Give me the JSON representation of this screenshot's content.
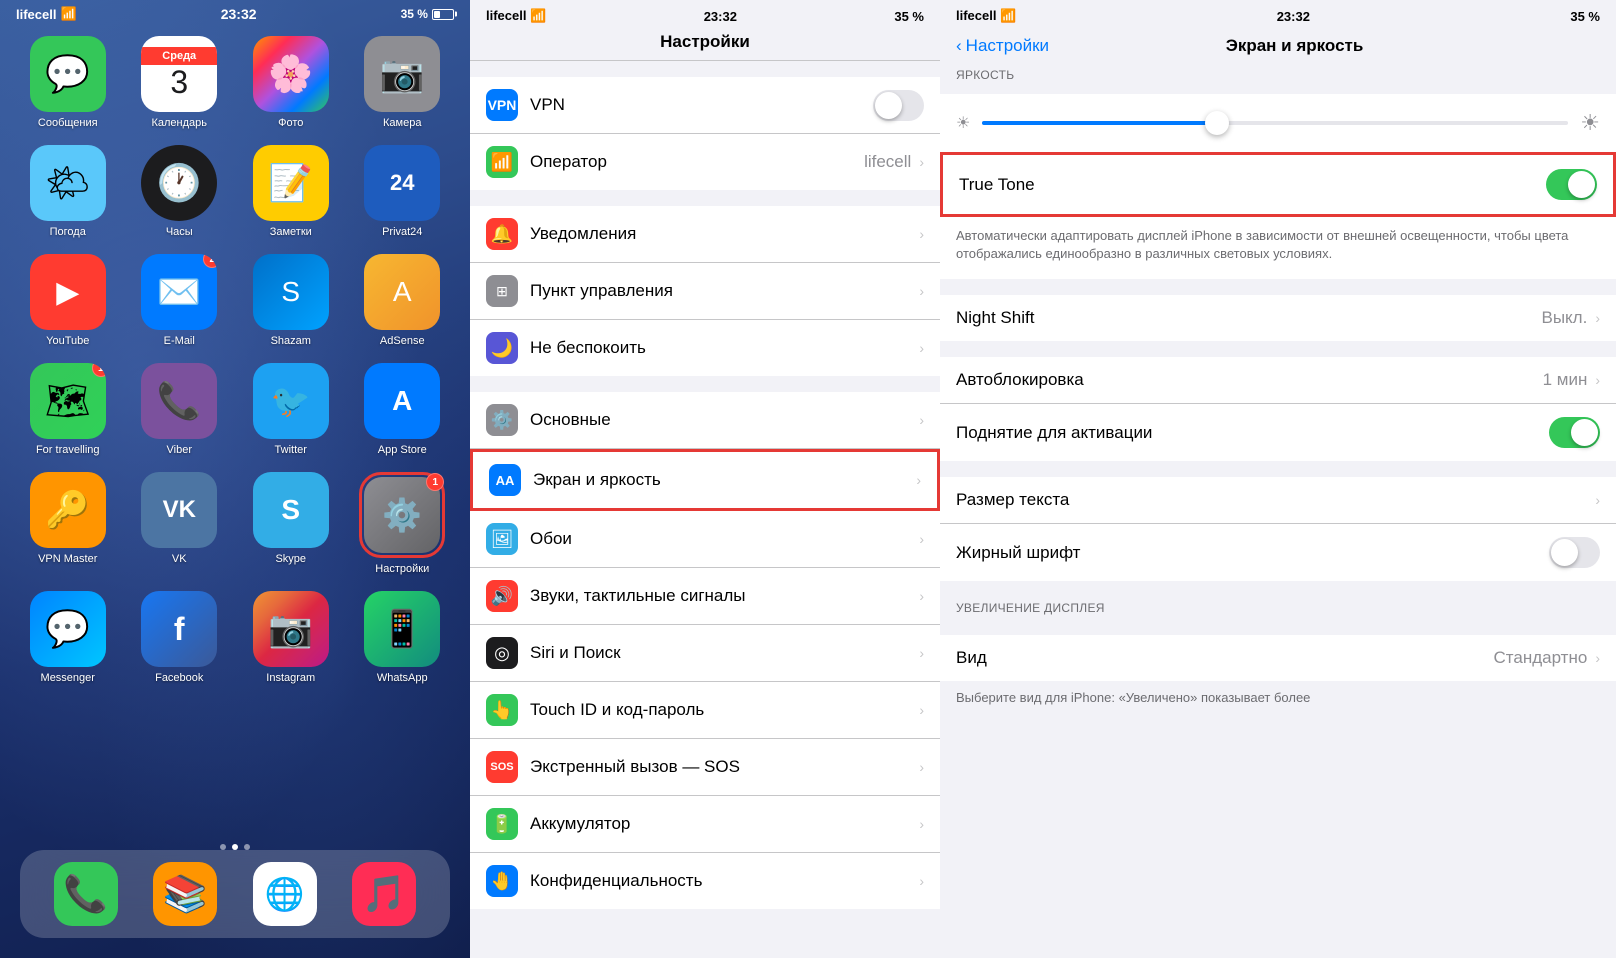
{
  "panels": {
    "home": {
      "status": {
        "carrier": "lifecell",
        "wifi": true,
        "time": "23:32",
        "battery": "35 %"
      },
      "apps_row1": [
        {
          "id": "messages",
          "label": "Сообщения",
          "emoji": "💬",
          "bg": "bg-green"
        },
        {
          "id": "calendar",
          "label": "Календарь",
          "day_name": "Среда",
          "day_num": "3"
        },
        {
          "id": "photos",
          "label": "Фото",
          "emoji": "🌸",
          "bg": "bg-gradient-insta"
        },
        {
          "id": "camera",
          "label": "Камера",
          "emoji": "📷",
          "bg": "bg-gray"
        }
      ],
      "apps_row2": [
        {
          "id": "weather",
          "label": "Погода",
          "emoji": "🌤",
          "bg": "bg-lightblue"
        },
        {
          "id": "clock",
          "label": "Часы",
          "emoji": "🕐"
        },
        {
          "id": "notes",
          "label": "Заметки",
          "emoji": "📝",
          "bg": "bg-yellow"
        },
        {
          "id": "privat24",
          "label": "Privat24",
          "emoji": "24",
          "bg": "bg-green"
        }
      ],
      "apps_row3": [
        {
          "id": "youtube",
          "label": "YouTube",
          "emoji": "▶",
          "bg": "bg-red"
        },
        {
          "id": "email",
          "label": "E-Mail",
          "emoji": "✉️",
          "bg": "bg-blue",
          "badge": "2"
        },
        {
          "id": "shazam",
          "label": "Shazam",
          "emoji": "S",
          "bg": "bg-blue"
        },
        {
          "id": "adsense",
          "label": "AdSense",
          "emoji": "A",
          "bg": "bg-gradient-yellow"
        }
      ],
      "apps_row4": [
        {
          "id": "maps",
          "label": "For travelling",
          "emoji": "🗺",
          "bg": "bg-maps",
          "badge": "1"
        },
        {
          "id": "viber",
          "label": "Viber",
          "emoji": "📞",
          "bg": "bg-viber"
        },
        {
          "id": "twitter",
          "label": "Twitter",
          "emoji": "🐦",
          "bg": "bg-twitter"
        },
        {
          "id": "appstore",
          "label": "App Store",
          "emoji": "A",
          "bg": "bg-blue"
        }
      ],
      "apps_row5": [
        {
          "id": "vpnmaster",
          "label": "VPN Master",
          "emoji": "🔑",
          "bg": "bg-orange"
        },
        {
          "id": "vk",
          "label": "VK",
          "emoji": "V",
          "bg": "bg-blue"
        },
        {
          "id": "skype",
          "label": "Skype",
          "emoji": "S",
          "bg": "bg-teal"
        },
        {
          "id": "settings",
          "label": "Настройки",
          "emoji": "⚙️",
          "badge": "1",
          "highlight": true
        }
      ],
      "apps_row6": [
        {
          "id": "messenger",
          "label": "Messenger",
          "emoji": "💬",
          "bg": "bg-gradient-messenger"
        },
        {
          "id": "facebook",
          "label": "Facebook",
          "emoji": "f",
          "bg": "bg-gradient-blue"
        },
        {
          "id": "instagram",
          "label": "Instagram",
          "emoji": "📷",
          "bg": "bg-gradient-insta"
        },
        {
          "id": "whatsapp",
          "label": "WhatsApp",
          "emoji": "📱",
          "bg": "bg-gradient-green"
        }
      ],
      "dock": [
        {
          "id": "phone",
          "label": "",
          "emoji": "📞",
          "bg": "bg-green"
        },
        {
          "id": "books",
          "label": "",
          "emoji": "📚",
          "bg": "bg-orange"
        },
        {
          "id": "chrome",
          "label": "",
          "emoji": "●",
          "bg": "bg-white"
        },
        {
          "id": "music",
          "label": "",
          "emoji": "♪",
          "bg": "bg-pink"
        }
      ],
      "dots": [
        false,
        true,
        false
      ]
    },
    "settings": {
      "status": {
        "carrier": "lifecell",
        "wifi": true,
        "time": "23:32",
        "battery": "35 %"
      },
      "title": "Настройки",
      "rows_top": [
        {
          "id": "vpn",
          "label": "VPN",
          "icon": "🔒",
          "icon_bg": "icon-blue",
          "type": "toggle",
          "value": false
        },
        {
          "id": "operator",
          "label": "Оператор",
          "icon": "📶",
          "icon_bg": "icon-green",
          "type": "value",
          "value": "lifecell"
        }
      ],
      "rows_main": [
        {
          "id": "notifications",
          "label": "Уведомления",
          "icon": "🔔",
          "icon_bg": "icon-red",
          "type": "arrow"
        },
        {
          "id": "control",
          "label": "Пункт управления",
          "icon": "⊞",
          "icon_bg": "icon-gray",
          "type": "arrow"
        },
        {
          "id": "dnd",
          "label": "Не беспокоить",
          "icon": "🌙",
          "icon_bg": "icon-purple",
          "type": "arrow"
        }
      ],
      "rows_secondary": [
        {
          "id": "general",
          "label": "Основные",
          "icon": "⚙️",
          "icon_bg": "icon-gray",
          "type": "arrow"
        },
        {
          "id": "screen",
          "label": "Экран и яркость",
          "icon": "AA",
          "icon_bg": "icon-blue",
          "type": "arrow",
          "highlight": true
        },
        {
          "id": "wallpaper",
          "label": "Обои",
          "icon": "🖼",
          "icon_bg": "icon-teal",
          "type": "arrow"
        },
        {
          "id": "sounds",
          "label": "Звуки, тактильные сигналы",
          "icon": "🔊",
          "icon_bg": "icon-red",
          "type": "arrow"
        },
        {
          "id": "siri",
          "label": "Siri и Поиск",
          "icon": "◎",
          "icon_bg": "icon-dark",
          "type": "arrow"
        },
        {
          "id": "touchid",
          "label": "Touch ID и код-пароль",
          "icon": "👆",
          "icon_bg": "icon-green",
          "type": "arrow"
        },
        {
          "id": "sos",
          "label": "Экстренный вызов — SOS",
          "icon": "SOS",
          "icon_bg": "icon-sos",
          "type": "arrow"
        },
        {
          "id": "battery",
          "label": "Аккумулятор",
          "icon": "🔋",
          "icon_bg": "icon-green",
          "type": "arrow"
        },
        {
          "id": "privacy",
          "label": "Конфиденциальность",
          "icon": "🤚",
          "icon_bg": "icon-blue",
          "type": "arrow"
        }
      ]
    },
    "brightness": {
      "status": {
        "carrier": "lifecell",
        "wifi": true,
        "time": "23:32",
        "battery": "35 %"
      },
      "back_label": "Настройки",
      "title": "Экран и яркость",
      "section_brightness": "ЯРКОСТЬ",
      "brightness_value": 40,
      "true_tone": {
        "label": "True Tone",
        "enabled": true,
        "description": "Автоматически адаптировать дисплей iPhone в зависимости от внешней освещенности, чтобы цвета отображались единообразно в различных световых условиях."
      },
      "night_shift": {
        "label": "Night Shift",
        "value": "Выкл."
      },
      "rows": [
        {
          "id": "autolock",
          "label": "Автоблокировка",
          "value": "1 мин"
        },
        {
          "id": "raise",
          "label": "Поднятие для активации",
          "type": "toggle",
          "value": true
        }
      ],
      "text_rows": [
        {
          "id": "textsize",
          "label": "Размер текста"
        },
        {
          "id": "bold",
          "label": "Жирный шрифт",
          "type": "toggle",
          "value": false
        }
      ],
      "section_display": "УВЕЛИЧЕНИЕ ДИСПЛЕЯ",
      "display_rows": [
        {
          "id": "view",
          "label": "Вид",
          "value": "Стандартно"
        }
      ],
      "display_note": "Выберите вид для iPhone: «Увеличено» показывает более"
    }
  }
}
